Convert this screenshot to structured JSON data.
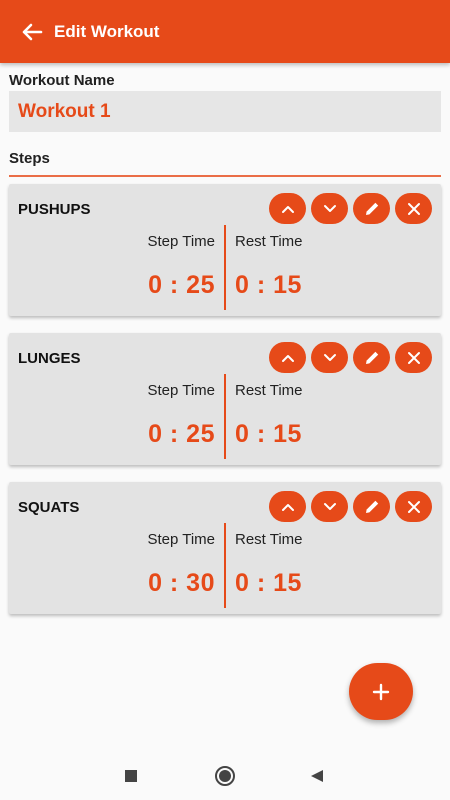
{
  "app_bar": {
    "title": "Edit Workout",
    "back_icon": "arrow-back-icon",
    "color": "#e64a19"
  },
  "form": {
    "name_label": "Workout Name",
    "name_value": "Workout 1",
    "steps_label": "Steps"
  },
  "steps": [
    {
      "name": "PUSHUPS",
      "step_label": "Step Time",
      "rest_label": "Rest Time",
      "step_time": "0 : 25",
      "rest_time": "0 : 15"
    },
    {
      "name": "LUNGES",
      "step_label": "Step Time",
      "rest_label": "Rest Time",
      "step_time": "0 : 25",
      "rest_time": "0 : 15"
    },
    {
      "name": "SQUATS",
      "step_label": "Step Time",
      "rest_label": "Rest Time",
      "step_time": "0 : 30",
      "rest_time": "0 : 15"
    }
  ],
  "step_action_icons": [
    "chevron-up-icon",
    "chevron-down-icon",
    "pencil-icon",
    "close-icon"
  ],
  "fab_icon": "plus-icon",
  "nav_bar": {
    "icons": [
      "recent-apps-icon",
      "home-icon",
      "back-icon"
    ]
  }
}
